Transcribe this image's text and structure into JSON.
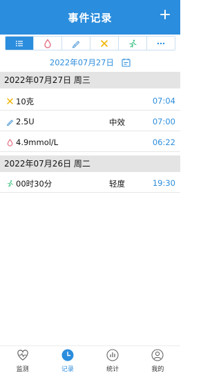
{
  "header": {
    "title": "事件记录"
  },
  "filters": [
    {
      "icon": "list-icon",
      "active": true
    },
    {
      "icon": "blood-drop-icon",
      "active": false
    },
    {
      "icon": "pen-icon",
      "active": false
    },
    {
      "icon": "fork-knife-icon",
      "active": false
    },
    {
      "icon": "running-icon",
      "active": false
    },
    {
      "icon": "more-icon",
      "active": false
    }
  ],
  "date_selector": {
    "date": "2022年07月27日"
  },
  "groups": [
    {
      "date": "2022年07月27日 周三",
      "rows": [
        {
          "icon": "fork-knife-icon",
          "value": "10克",
          "extra": "",
          "time": "07:04"
        },
        {
          "icon": "pen-icon",
          "value": "2.5U",
          "extra": "中效",
          "time": "07:00"
        },
        {
          "icon": "blood-drop-icon",
          "value": "4.9mmol/L",
          "extra": "",
          "time": "06:22"
        }
      ]
    },
    {
      "date": "2022年07月26日 周二",
      "rows": [
        {
          "icon": "running-icon",
          "value": "00时30分",
          "extra": "轻度",
          "time": "19:30"
        }
      ]
    }
  ],
  "bottom_nav": [
    {
      "label": "监测",
      "icon": "monitor-icon",
      "active": false
    },
    {
      "label": "记录",
      "icon": "clock-icon",
      "active": true
    },
    {
      "label": "统计",
      "icon": "stats-icon",
      "active": false
    },
    {
      "label": "我的",
      "icon": "user-icon",
      "active": false
    }
  ],
  "colors": {
    "accent": "#2b8ddd",
    "glucose": "#e0647a",
    "insulin": "#5b9fd9",
    "meal": "#f0b400",
    "exercise": "#4cc78c"
  }
}
